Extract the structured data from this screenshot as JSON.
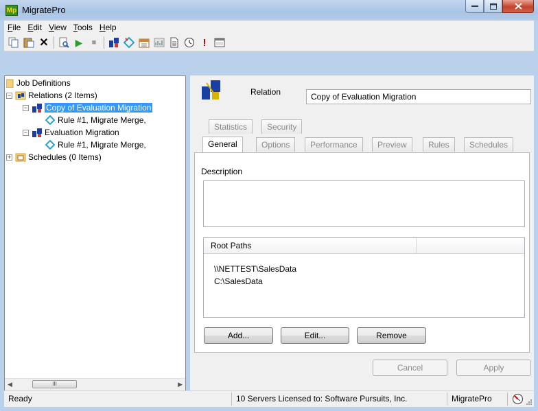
{
  "window": {
    "title": "MigratePro",
    "app_icon_text": "Mp"
  },
  "menu": [
    {
      "label": "File",
      "key": "F",
      "rest": "ile"
    },
    {
      "label": "Edit",
      "key": "E",
      "rest": "dit"
    },
    {
      "label": "View",
      "key": "V",
      "rest": "iew"
    },
    {
      "label": "Tools",
      "key": "T",
      "rest": "ools"
    },
    {
      "label": "Help",
      "key": "H",
      "rest": "elp"
    }
  ],
  "toolbar": {
    "icons": [
      "copy-icon",
      "paste-icon",
      "delete-icon",
      "preview-icon",
      "run-icon",
      "stop-icon",
      "relation-icon",
      "rule-icon",
      "schedule-icon",
      "report-icon",
      "document-icon",
      "clock-icon",
      "alert-icon",
      "window-icon"
    ],
    "delete_glyph": "✕",
    "run_glyph": "▶",
    "stop_glyph": "■",
    "alert_glyph": "!"
  },
  "tree": {
    "root": "Job Definitions",
    "relations": "Relations (2 Items)",
    "items": [
      {
        "label": "Copy of Evaluation Migration",
        "rule": "Rule #1, Migrate Merge,",
        "selected": true
      },
      {
        "label": "Evaluation Migration",
        "rule": "Rule #1, Migrate Merge,",
        "selected": false
      }
    ],
    "schedules": "Schedules (0 Items)",
    "scroll_thumb_glyph": "III"
  },
  "relation": {
    "label": "Relation",
    "value": "Copy of Evaluation Migration"
  },
  "tabs_top": [
    "Statistics",
    "Security"
  ],
  "tabs_bottom": [
    "General",
    "Options",
    "Performance",
    "Preview",
    "Rules",
    "Schedules"
  ],
  "active_tab": "General",
  "general": {
    "description_label": "Description",
    "description_value": "",
    "root_paths_header": "Root Paths",
    "root_paths": [
      "\\\\NETTEST\\SalesData",
      "C:\\SalesData"
    ],
    "add_label": "Add...",
    "edit_label": "Edit...",
    "remove_label": "Remove"
  },
  "footer_buttons": {
    "cancel": "Cancel",
    "apply": "Apply"
  },
  "status": {
    "state": "Ready",
    "license": "10 Servers Licensed to: Software Pursuits, Inc.",
    "product": "MigratePro"
  },
  "colors": {
    "selection": "#3399ff",
    "close_button": "#c4422b",
    "window_frame": "#b9d1ea"
  }
}
